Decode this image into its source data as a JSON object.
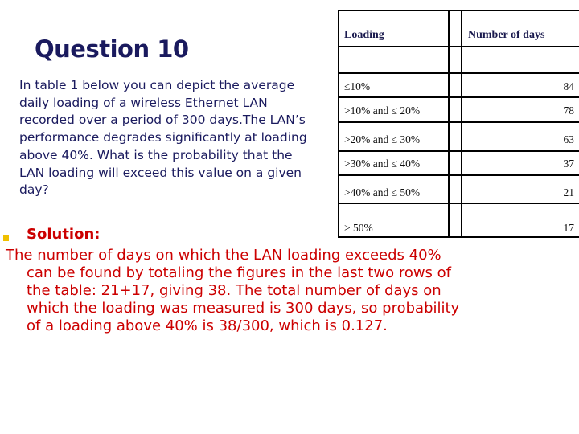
{
  "title": "Question 10",
  "question": "In table 1 below you can depict the average daily loading of a wireless Ethernet LAN recorded over a period of 300 days.The LAN’s performance degrades significantly at loading above 40%. What is the probability that the LAN loading will exceed this value on a given day?",
  "table": {
    "headers": {
      "loading": "Loading",
      "days": "Number of days"
    },
    "rows": [
      {
        "loading": "≤10%",
        "days": "84"
      },
      {
        "loading": ">10% and ≤ 20%",
        "days": "78"
      },
      {
        "loading": ">20% and ≤ 30%",
        "days": "63"
      },
      {
        "loading": ">30% and ≤ 40%",
        "days": "37"
      },
      {
        "loading": ">40% and ≤ 50%",
        "days": "21"
      },
      {
        "loading": "> 50%",
        "days": "17"
      }
    ]
  },
  "solution": {
    "label": "Solution:",
    "text": "The number of days on which the LAN loading exceeds 40% can be found by totaling the figures in the last two rows of the table: 21+17, giving 38. The total number of days on which the loading was measured is 300 days, so probability of a loading above 40% is  38/300, which is 0.127."
  },
  "colors": {
    "title": "#1a1a5e",
    "solution": "#cc0000",
    "bullet": "#f0c000"
  }
}
